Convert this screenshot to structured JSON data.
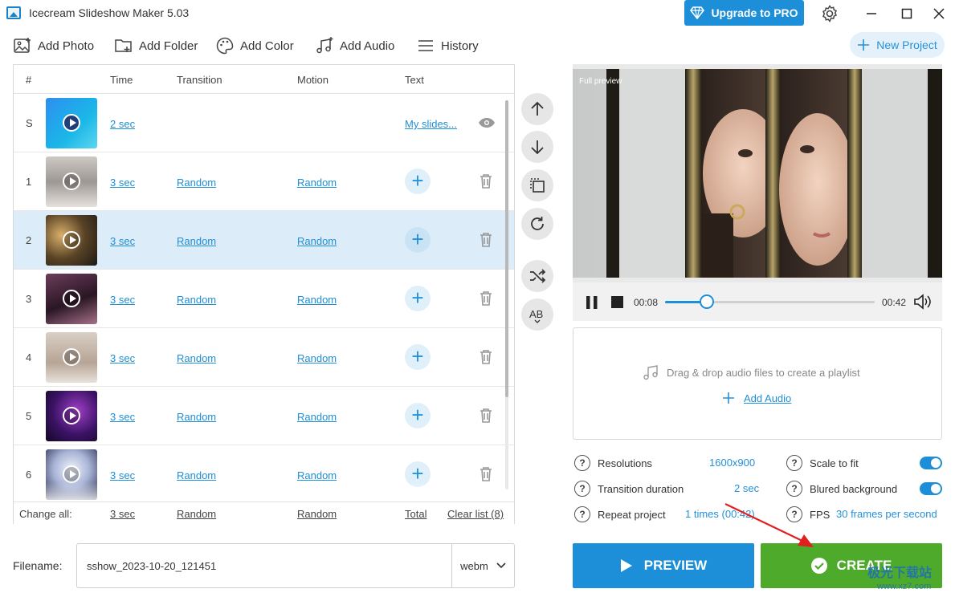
{
  "app": {
    "title": "Icecream Slideshow Maker 5.03",
    "upgrade_label": "Upgrade to PRO"
  },
  "toolbar": {
    "add_photo": "Add Photo",
    "add_folder": "Add Folder",
    "add_color": "Add Color",
    "add_audio": "Add Audio",
    "history": "History",
    "new_project": "New Project"
  },
  "table": {
    "headers": {
      "num": "#",
      "time": "Time",
      "transition": "Transition",
      "motion": "Motion",
      "text": "Text"
    },
    "start_row": {
      "num": "S",
      "time": "2 sec",
      "text": "My slides..."
    },
    "rows": [
      {
        "num": "1",
        "time": "3 sec",
        "transition": "Random",
        "motion": "Random"
      },
      {
        "num": "2",
        "time": "3 sec",
        "transition": "Random",
        "motion": "Random"
      },
      {
        "num": "3",
        "time": "3 sec",
        "transition": "Random",
        "motion": "Random"
      },
      {
        "num": "4",
        "time": "3 sec",
        "transition": "Random",
        "motion": "Random"
      },
      {
        "num": "5",
        "time": "3 sec",
        "transition": "Random",
        "motion": "Random"
      },
      {
        "num": "6",
        "time": "3 sec",
        "transition": "Random",
        "motion": "Random"
      }
    ],
    "selected_row": "2",
    "footer": {
      "label": "Change all:",
      "time": "3 sec",
      "transition": "Random",
      "motion": "Random",
      "total": "Total",
      "clear": "Clear list (8)"
    }
  },
  "file": {
    "label": "Filename:",
    "value": "sshow_2023-10-20_121451",
    "format": "webm"
  },
  "preview": {
    "label": "Full preview",
    "current_time": "00:08",
    "total_time": "00:42",
    "progress": 0.2
  },
  "audio": {
    "hint": "Drag & drop audio files to create a playlist",
    "add_label": "Add Audio"
  },
  "settings": {
    "resolutions_label": "Resolutions",
    "resolutions_value": "1600x900",
    "transition_label": "Transition duration",
    "transition_value": "2 sec",
    "repeat_label": "Repeat project",
    "repeat_value": "1 times (00:42)",
    "scale_label": "Scale to fit",
    "scale_on": true,
    "blur_label": "Blured background",
    "blur_on": true,
    "fps_label": "FPS",
    "fps_value": "30 frames per second"
  },
  "actions": {
    "preview_label": "PREVIEW",
    "create_label": "CREATE"
  },
  "watermark": {
    "line1": "极光下载站",
    "line2": "www.xz7.com"
  },
  "colors": {
    "accent": "#1d8fd8",
    "create": "#4eaa2b",
    "selected_row": "#dcedf9"
  }
}
